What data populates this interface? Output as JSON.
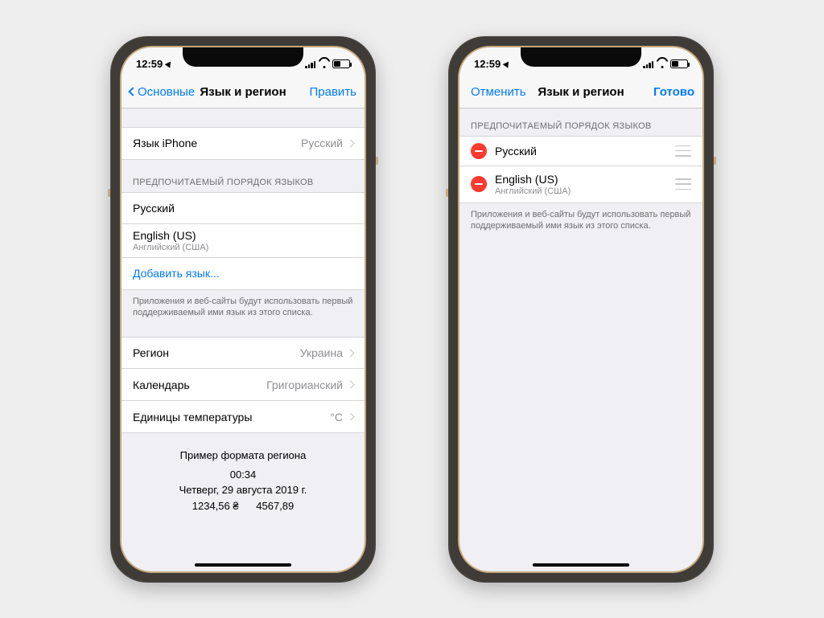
{
  "statusbar": {
    "time": "12:59"
  },
  "left": {
    "nav": {
      "back": "Основные",
      "title": "Язык и регион",
      "edit": "Править"
    },
    "iphone_lang_row": {
      "label": "Язык iPhone",
      "value": "Русский"
    },
    "pref_header": "ПРЕДПОЧИТАЕМЫЙ ПОРЯДОК ЯЗЫКОВ",
    "langs": [
      {
        "name": "Русский",
        "sub": ""
      },
      {
        "name": "English (US)",
        "sub": "Английский (США)"
      }
    ],
    "add_lang": "Добавить язык...",
    "footer": "Приложения и веб-сайты будут использовать первый поддерживаемый ими язык из этого списка.",
    "region_row": {
      "label": "Регион",
      "value": "Украина"
    },
    "calendar_row": {
      "label": "Календарь",
      "value": "Григорианский"
    },
    "temp_row": {
      "label": "Единицы температуры",
      "value": "°C"
    },
    "example": {
      "title": "Пример формата региона",
      "time": "00:34",
      "date": "Четверг, 29 августа 2019 г.",
      "numbers": "1234,56 ₴      4567,89"
    }
  },
  "right": {
    "nav": {
      "cancel": "Отменить",
      "title": "Язык и регион",
      "done": "Готово"
    },
    "pref_header": "ПРЕДПОЧИТАЕМЫЙ ПОРЯДОК ЯЗЫКОВ",
    "langs": [
      {
        "name": "Русский",
        "sub": ""
      },
      {
        "name": "English (US)",
        "sub": "Английский (США)"
      }
    ],
    "footer": "Приложения и веб-сайты будут использовать первый поддерживаемый ими язык из этого списка."
  }
}
